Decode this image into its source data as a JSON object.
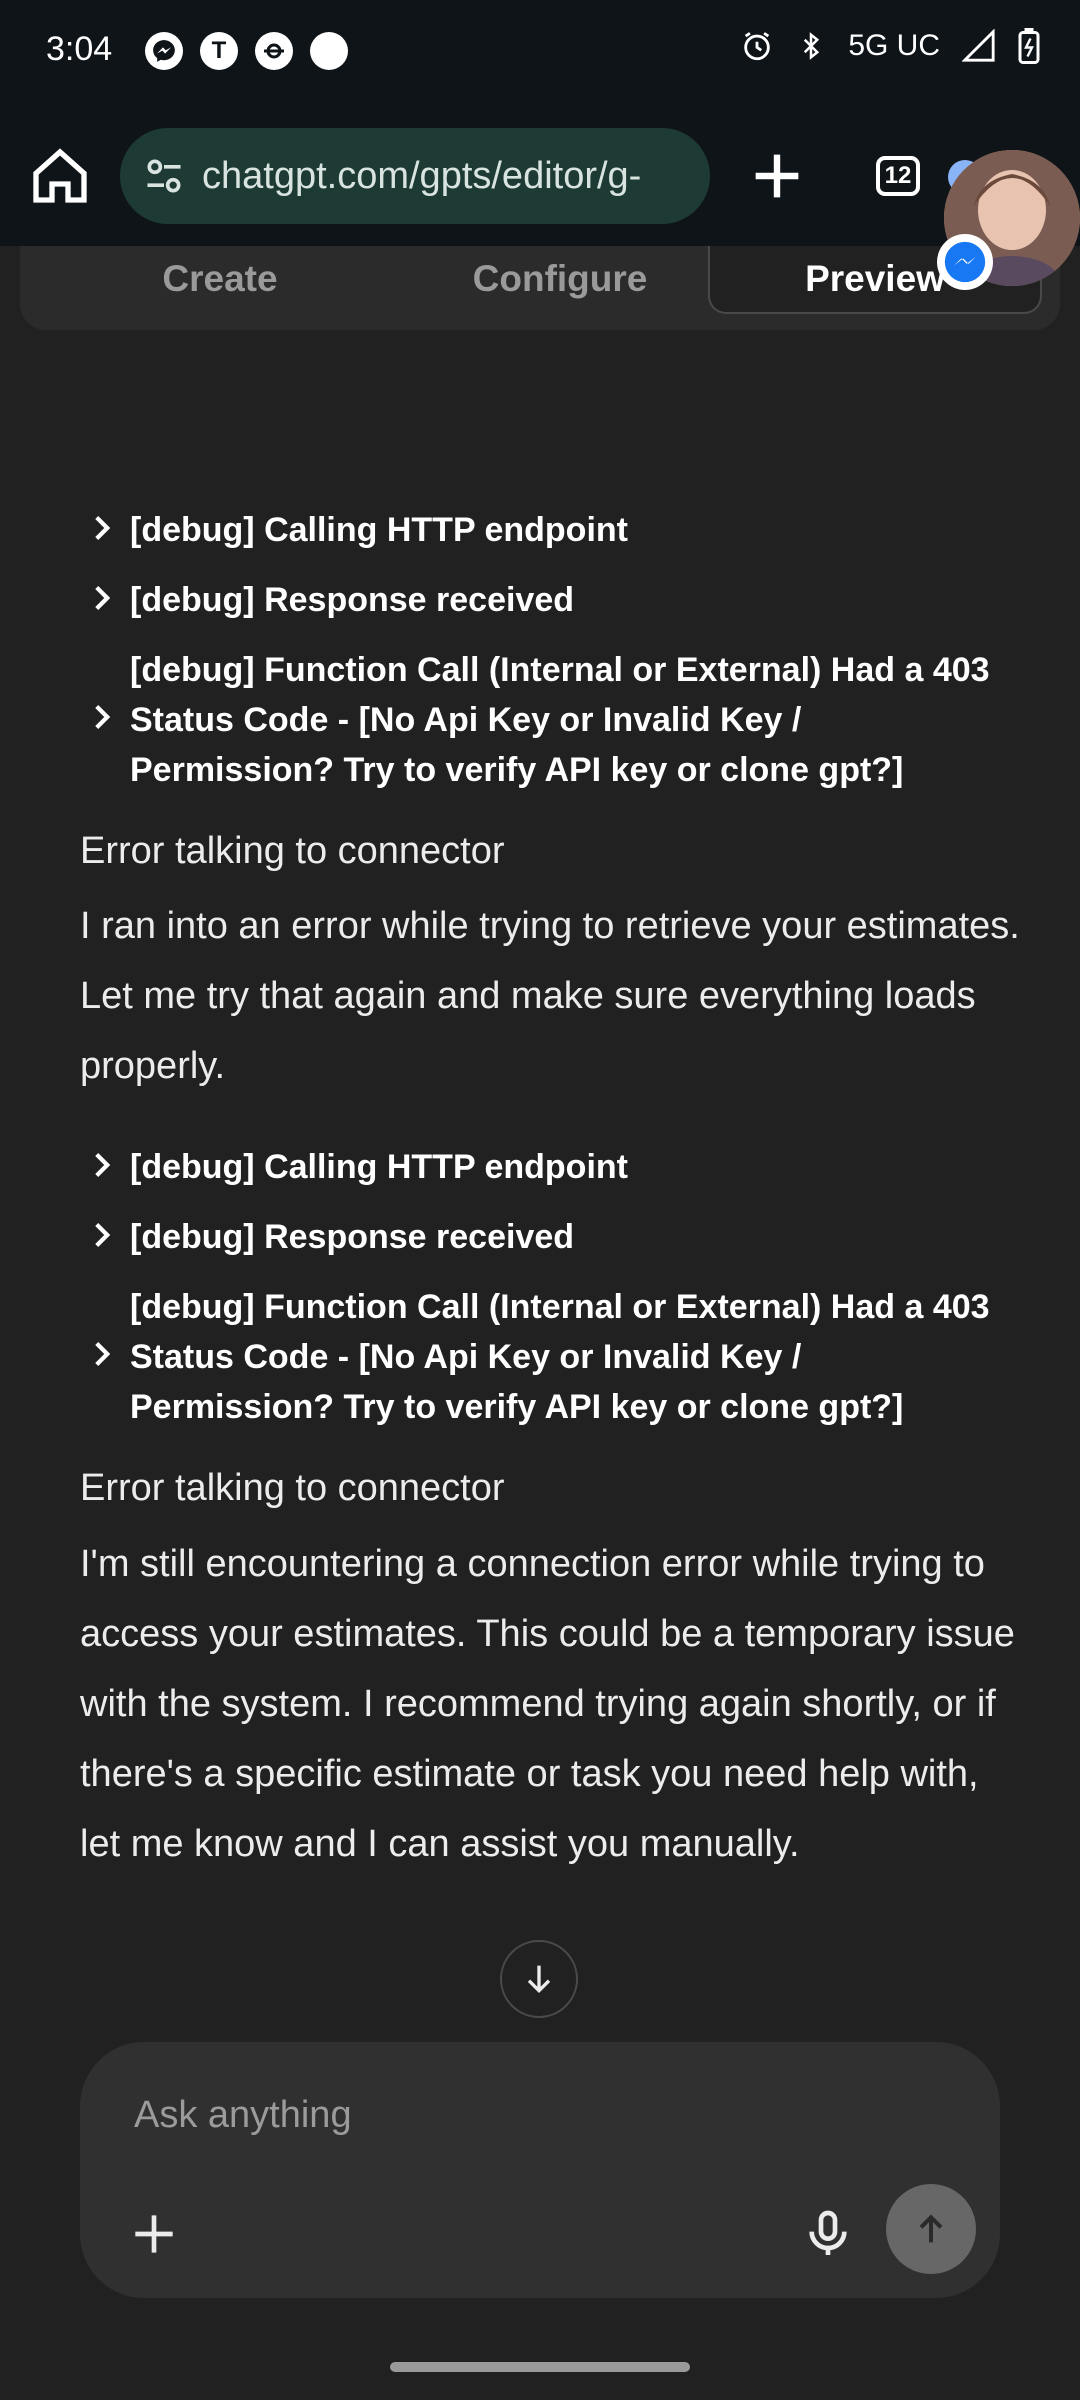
{
  "status_bar": {
    "time": "3:04",
    "network": "5G UC",
    "notification_icons": [
      "messenger-icon",
      "t-app-icon",
      "sync-icon",
      "circle-icon"
    ]
  },
  "browser": {
    "url": "chatgpt.com/gpts/editor/g-",
    "tab_count": "12"
  },
  "tabs": [
    {
      "label": "Create"
    },
    {
      "label": "Configure"
    },
    {
      "label": "Preview"
    }
  ],
  "conversation": {
    "debug_1a": "[debug] Calling HTTP endpoint",
    "debug_1b": "[debug] Response received",
    "debug_1c": "[debug] Function Call (Internal or External) Had a 403 Status Code - [No Api Key or Invalid Key / Permission? Try to verify API key or clone gpt?]",
    "error_1": "Error talking to connector",
    "message_1": "I ran into an error while trying to retrieve your estimates. Let me try that again and make sure everything loads properly.",
    "debug_2a": "[debug] Calling HTTP endpoint",
    "debug_2b": "[debug] Response received",
    "debug_2c": "[debug] Function Call (Internal or External) Had a 403 Status Code - [No Api Key or Invalid Key / Permission? Try to verify API key or clone gpt?]",
    "error_2": "Error talking to connector",
    "message_2": "I'm still encountering a connection error while trying to access your estimates. This could be a temporary issue with the system. I recommend trying again shortly, or if there's a specific estimate or task you need help with, let me know and I can assist you manually."
  },
  "composer": {
    "placeholder": "Ask anything"
  }
}
